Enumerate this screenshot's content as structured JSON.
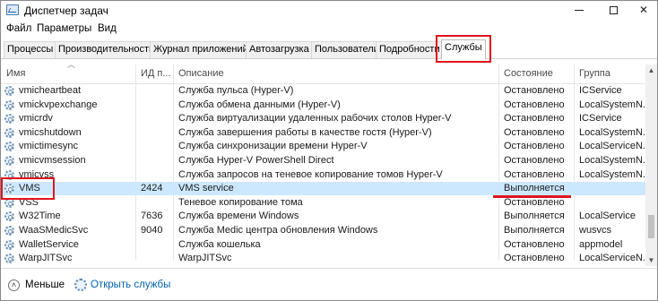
{
  "window": {
    "title": "Диспетчер задач",
    "close_glyph": "✕"
  },
  "menu": [
    "Файл",
    "Параметры",
    "Вид"
  ],
  "tabs": [
    "Процессы",
    "Производительность",
    "Журнал приложений",
    "Автозагрузка",
    "Пользователи",
    "Подробности",
    "Службы"
  ],
  "active_tab": "Службы",
  "columns": [
    "Имя",
    "ИД п...",
    "Описание",
    "Состояние",
    "Группа"
  ],
  "rows": [
    {
      "name": "vmicheartbeat",
      "pid": "",
      "desc": "Служба пульса (Hyper-V)",
      "state": "Остановлено",
      "group": "ICService"
    },
    {
      "name": "vmickvpexchange",
      "pid": "",
      "desc": "Служба обмена данными (Hyper-V)",
      "state": "Остановлено",
      "group": "LocalSystemN..."
    },
    {
      "name": "vmicrdv",
      "pid": "",
      "desc": "Служба виртуализации удаленных рабочих столов Hyper-V",
      "state": "Остановлено",
      "group": "ICService"
    },
    {
      "name": "vmicshutdown",
      "pid": "",
      "desc": "Служба завершения работы в качестве гостя (Hyper-V)",
      "state": "Остановлено",
      "group": "LocalSystemN..."
    },
    {
      "name": "vmictimesync",
      "pid": "",
      "desc": "Служба синхронизации времени Hyper-V",
      "state": "Остановлено",
      "group": "LocalServiceN..."
    },
    {
      "name": "vmicvmsession",
      "pid": "",
      "desc": "Служба Hyper-V PowerShell Direct",
      "state": "Остановлено",
      "group": "LocalSystemN..."
    },
    {
      "name": "vmicvss",
      "pid": "",
      "desc": "Служба запросов на теневое копирование томов Hyper-V",
      "state": "Остановлено",
      "group": "LocalSystemN..."
    },
    {
      "name": "VMS",
      "pid": "2424",
      "desc": "VMS service",
      "state": "Выполняется",
      "group": ""
    },
    {
      "name": "VSS",
      "pid": "",
      "desc": "Теневое копирование тома",
      "state": "Остановлено",
      "group": ""
    },
    {
      "name": "W32Time",
      "pid": "7636",
      "desc": "Служба времени Windows",
      "state": "Выполняется",
      "group": "LocalService"
    },
    {
      "name": "WaaSMedicSvc",
      "pid": "9040",
      "desc": "Служба Medic центра обновления Windows",
      "state": "Выполняется",
      "group": "wusvcs"
    },
    {
      "name": "WalletService",
      "pid": "",
      "desc": "Служба кошелька",
      "state": "Остановлено",
      "group": "appmodel"
    },
    {
      "name": "WarpJITSvc",
      "pid": "",
      "desc": "WarpJITSvc",
      "state": "Остановлено",
      "group": "LocalServiceN..."
    }
  ],
  "selected_row": "VMS",
  "footer": {
    "less": "Меньше",
    "open_services": "Открыть службы"
  },
  "colors": {
    "highlight": "#e0141e",
    "selected_row": "#cce8ff",
    "link": "#0063b1"
  }
}
